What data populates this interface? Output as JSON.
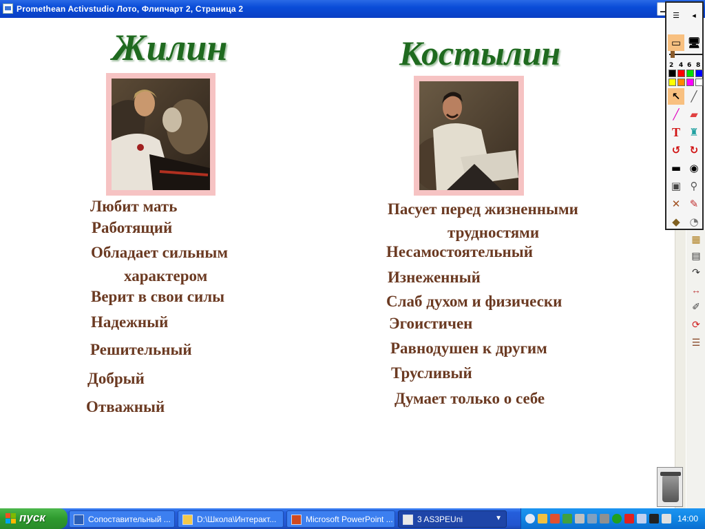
{
  "window": {
    "title": "Promethean Activstudio   Лото,  Флипчарт 2,  Страница 2"
  },
  "flipchart": {
    "left_heading": "Жилин",
    "right_heading": "Костылин",
    "left_traits": [
      "Любит мать",
      "Работящий",
      "Обладает сильным",
      "характером",
      "Верит в свои силы",
      "Надежный",
      "Решительный",
      "Добрый",
      "Отважный"
    ],
    "right_traits": [
      "Пасует перед жизненными",
      "трудностями",
      "Несамостоятельный",
      "Изнеженный",
      "Слаб духом и физически",
      "Эгоистичен",
      "Равнодушен к другим",
      "Трусливый",
      "Думает только о себе"
    ],
    "heading_color": "#1f6a1f",
    "trait_color": "#6b3a22",
    "photo_frame_color": "#f6c3c3"
  },
  "toolbox": {
    "pen_widths": [
      "2",
      "4",
      "6",
      "8"
    ],
    "colors": [
      "#000000",
      "#ff0000",
      "#00dd00",
      "#0000ff",
      "#ffff00",
      "#ff8800",
      "#ff00ff",
      "#ffffff"
    ],
    "icons": [
      "pointer-icon",
      "pen-icon",
      "highlighter-icon",
      "eraser-icon",
      "text-icon",
      "fill-icon",
      "undo-icon",
      "redo-icon",
      "reveal-icon",
      "spotlight-icon",
      "camera-icon",
      "magnifier-icon",
      "tools-icon",
      "handwriting-icon",
      "paint-bucket-icon",
      "help-icon"
    ]
  },
  "taskbar": {
    "start_label": "пуск",
    "tasks": [
      {
        "label": "Сопоставительный ...",
        "icon": "word-icon"
      },
      {
        "label": "D:\\Школа\\Интеракт...",
        "icon": "folder-icon"
      },
      {
        "label": "Microsoft PowerPoint ...",
        "icon": "powerpoint-icon"
      },
      {
        "label": "3  AS3PEUni",
        "icon": "app-group-icon"
      }
    ],
    "clock": "14:00"
  }
}
